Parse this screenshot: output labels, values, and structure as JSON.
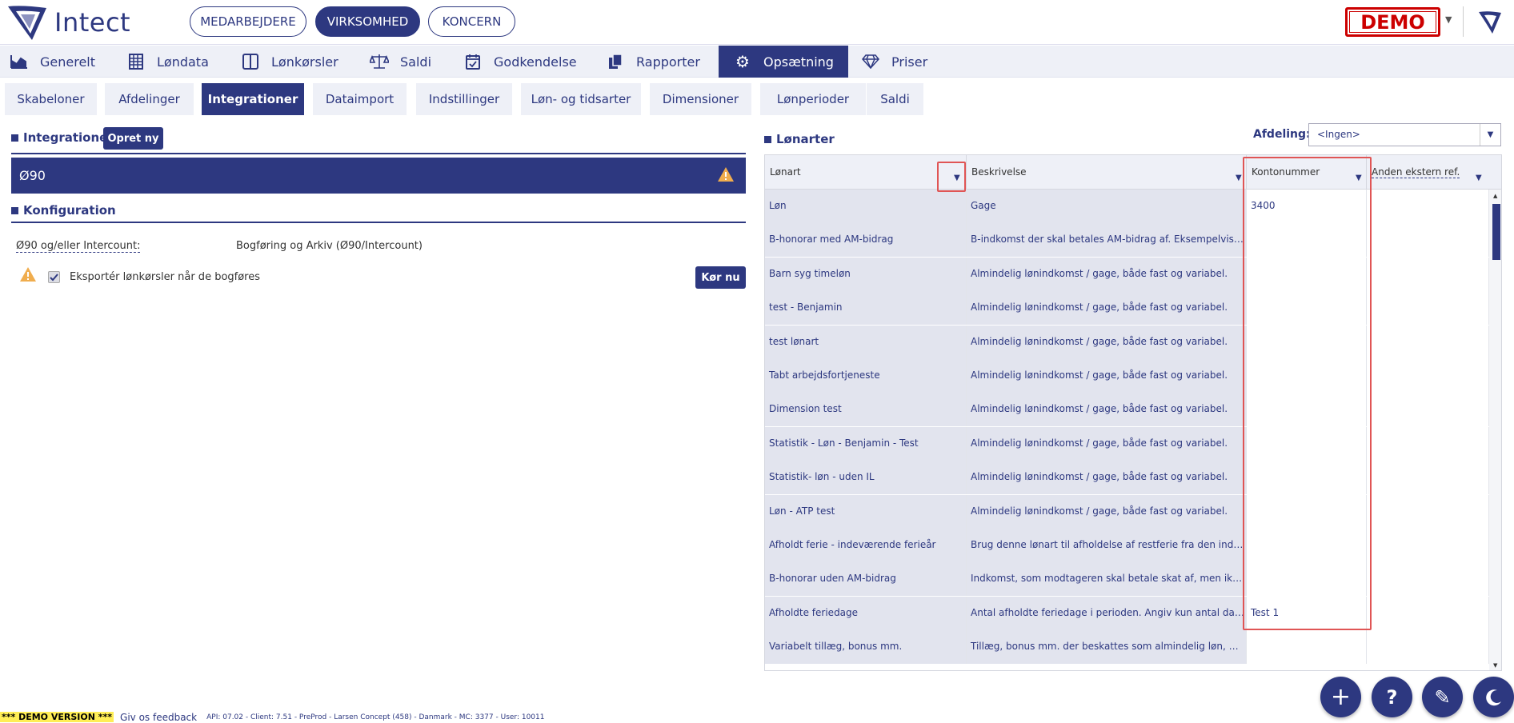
{
  "header": {
    "logo_text": "Intect",
    "tabs": [
      {
        "label": "MEDARBEJDERE",
        "active": false
      },
      {
        "label": "VIRKSOMHED",
        "active": true
      },
      {
        "label": "KONCERN",
        "active": false
      }
    ],
    "demo_badge": "DEMO"
  },
  "main_nav": [
    {
      "label": "Generelt",
      "icon": "chart-icon"
    },
    {
      "label": "Løndata",
      "icon": "table-icon"
    },
    {
      "label": "Lønkørsler",
      "icon": "columns-icon"
    },
    {
      "label": "Saldi",
      "icon": "scale-icon"
    },
    {
      "label": "Godkendelse",
      "icon": "calendar-check-icon"
    },
    {
      "label": "Rapporter",
      "icon": "copy-icon"
    },
    {
      "label": "Opsætning",
      "icon": "gear-icon",
      "active": true
    },
    {
      "label": "Priser",
      "icon": "diamond-icon"
    }
  ],
  "sub_nav": [
    {
      "label": "Skabeloner"
    },
    {
      "label": "Afdelinger"
    },
    {
      "label": "Integrationer",
      "active": true
    },
    {
      "label": "Dataimport"
    },
    {
      "label": "Indstillinger"
    },
    {
      "label": "Løn- og tidsarter"
    },
    {
      "label": "Dimensioner"
    },
    {
      "label": "Lønperioder"
    },
    {
      "label": "Saldi"
    }
  ],
  "integrations": {
    "title": "Integrationer",
    "create_button": "Opret ny",
    "selected": "Ø90"
  },
  "configuration": {
    "title": "Konfiguration",
    "label": "Ø90 og/eller Intercount:",
    "value": "Bogføring og Arkiv (Ø90/Intercount)",
    "export_label": "Eksportér lønkørsler når de bogføres",
    "export_checked": true,
    "run_button": "Kør nu"
  },
  "wage_types": {
    "title": "Lønarter",
    "department_label": "Afdeling:",
    "department_value": "<Ingen>",
    "columns": [
      "Lønart",
      "Beskrivelse",
      "Kontonummer",
      "Anden ekstern ref."
    ],
    "rows": [
      [
        "Løn",
        "Gage",
        "3400",
        ""
      ],
      [
        "B-honorar med AM-bidrag",
        "B-indkomst der skal betales AM-bidrag af. Eksempelvis honorarer",
        "",
        ""
      ],
      [
        "Barn syg timeløn",
        "Almindelig lønindkomst / gage, både fast og variabel.",
        "",
        ""
      ],
      [
        "test - Benjamin",
        "Almindelig lønindkomst / gage, både fast og variabel.",
        "",
        ""
      ],
      [
        "test lønart",
        "Almindelig lønindkomst / gage, både fast og variabel.",
        "",
        ""
      ],
      [
        "Tabt arbejdsfortjeneste",
        "Almindelig lønindkomst / gage, både fast og variabel.",
        "",
        ""
      ],
      [
        "Dimension test",
        "Almindelig lønindkomst / gage, både fast og variabel.",
        "",
        ""
      ],
      [
        "Statistik - Løn - Benjamin - Test",
        "Almindelig lønindkomst / gage, både fast og variabel.",
        "",
        ""
      ],
      [
        "Statistik- løn - uden IL",
        "Almindelig lønindkomst / gage, både fast og variabel.",
        "",
        ""
      ],
      [
        "Løn - ATP test",
        "Almindelig lønindkomst / gage, både fast og variabel.",
        "",
        ""
      ],
      [
        "Afholdt ferie - indeværende ferieår",
        "Brug denne lønart til afholdelse af restferie fra den indeværende",
        "",
        ""
      ],
      [
        "B-honorar uden AM-bidrag",
        "Indkomst, som modtageren skal betale skat af, men ikke AM-bidrag",
        "",
        ""
      ],
      [
        "Afholdte feriedage",
        "Antal afholdte feriedage i perioden. Angiv kun antal dage, ikke beløb",
        "Test 1",
        ""
      ],
      [
        "Variabelt tillæg, bonus mm.",
        "Tillæg, bonus mm. der beskattes som almindelig løn, men ikke",
        "",
        ""
      ]
    ]
  },
  "footer": {
    "demo_version": "*** DEMO VERSION ***",
    "feedback": "Giv os feedback",
    "info": "API: 07.02 - Client: 7.51 - PreProd  - Larsen Concept (458) - Danmark - MC: 3377  - User: 10011"
  },
  "colors": {
    "primary": "#2d3880",
    "nav_bg": "#eef0f7",
    "demo_red": "#cc0000",
    "highlight_red": "#e05555",
    "warning": "#f0ad4e"
  }
}
